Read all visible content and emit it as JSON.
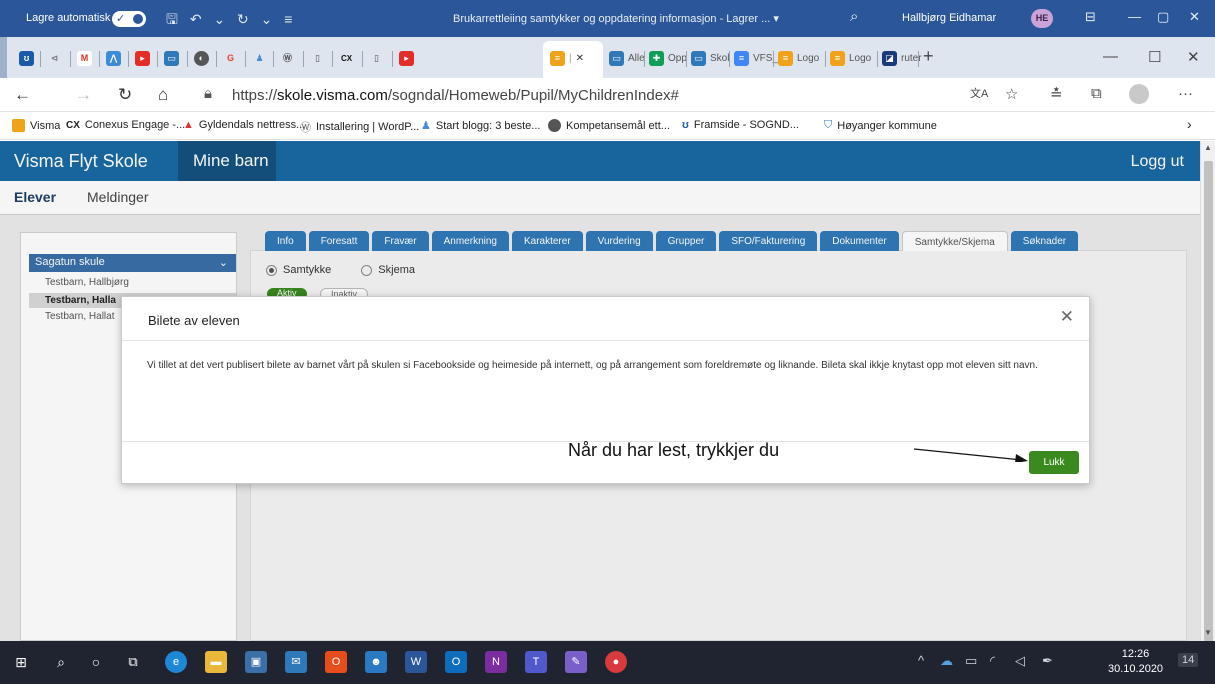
{
  "word": {
    "autosave_label": "Lagre automatisk",
    "doc_title": "Brukarrettleiing samtykker og oppdatering informasjon - Lagrer ... ▾",
    "user_name": "Hallbjørg Eidhamar",
    "user_initials": "HE"
  },
  "browser": {
    "tab_labels": [
      "Alle",
      "Opp",
      "Skol",
      "VFS_",
      "Logo",
      "Logo",
      "ruter"
    ],
    "url_prefix": "https://",
    "url_host": "skole.visma.com",
    "url_path": "/sogndal/Homeweb/Pupil/MyChildrenIndex#",
    "bookmarks": [
      "Visma",
      "Conexus Engage -...",
      "Gyldendals nettress...",
      "Installering | WordP...",
      "Start blogg: 3 beste...",
      "Kompetansemål ett...",
      "Framside - SOGND...",
      "Høyanger kommune"
    ]
  },
  "app": {
    "brand": "Visma Flyt Skole",
    "section": "Mine barn",
    "logout": "Logg ut",
    "subnav_active": "Elever",
    "subnav_other": "Meldinger",
    "school": "Sagatun skule",
    "students": [
      "Testbarn, Hallbjørg",
      "Testbarn, Halla",
      "Testbarn, Hallat"
    ],
    "tabs": [
      "Info",
      "Foresatt",
      "Fravær",
      "Anmerkning",
      "Karakterer",
      "Vurdering",
      "Grupper",
      "SFO/Fakturering",
      "Dokumenter",
      "Samtykke/Skjema",
      "Søknader"
    ],
    "radio_samtykke": "Samtykke",
    "radio_skjema": "Skjema",
    "pill_aktiv": "Aktiv",
    "pill_inaktiv": "Inaktiv"
  },
  "modal": {
    "title": "Bilete av eleven",
    "body": "Vi tillet at det vert publisert bilete av barnet vårt på skulen si Facebookside og heimeside på internett, og på arrangement som foreldremøte og liknande. Bileta skal ikkje knytast opp mot eleven sitt navn.",
    "close_label": "Lukk",
    "annotation": "Når du har lest, trykkjer du"
  },
  "taskbar": {
    "time": "12:26",
    "date": "30.10.2020",
    "notifications": "14"
  },
  "colors": {
    "word_blue": "#2b579a",
    "visma_header": "#1a6aa5",
    "tab_blue": "#2f79b9",
    "lukk_green": "#3a8a1f"
  }
}
